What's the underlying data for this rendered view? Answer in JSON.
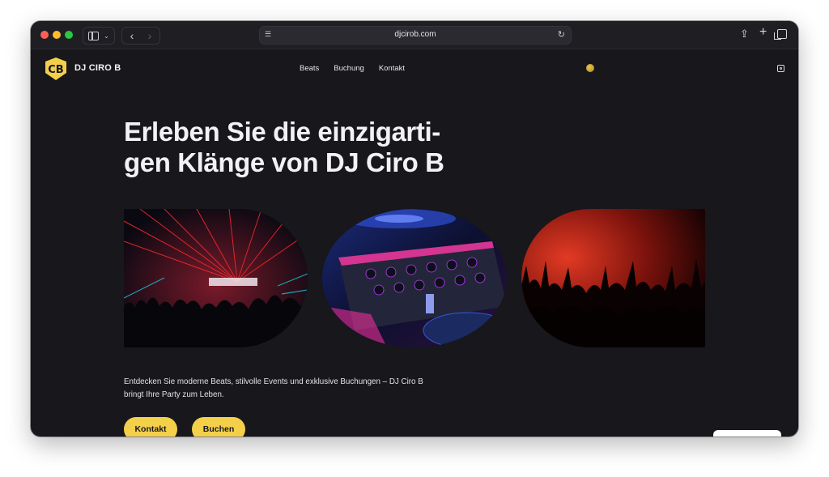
{
  "browser": {
    "url": "djcirob.com"
  },
  "site": {
    "brand": "DJ CIRO B",
    "logo_text": "CB",
    "nav": [
      "Beats",
      "Buchung",
      "Kontakt"
    ],
    "accent": "#f4cf4a",
    "background": "#17171c"
  },
  "hero": {
    "headline_line1": "Erleben Sie die einzigarti-",
    "headline_line2": "gen Klänge von DJ Ciro B",
    "lead": "Entdecken Sie moderne Beats, stilvolle Events und exklusive Buchungen – DJ Ciro B bringt Ihre Party zum Leben.",
    "buttons": {
      "kontakt": "Kontakt",
      "buchen": "Buchen"
    }
  },
  "icons": {
    "sidebar": "sidebar-icon",
    "back": "chevron-left-icon",
    "forward": "chevron-right-icon",
    "reload": "reload-icon",
    "share": "share-icon",
    "new_tab": "plus-icon",
    "tabs": "tabs-overview-icon",
    "language": "globe-icon",
    "social": "instagram-icon"
  }
}
